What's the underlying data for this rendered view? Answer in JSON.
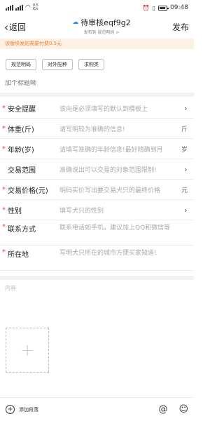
{
  "status_bar": {
    "net_speed": "0.5\nK/s",
    "time": "09:48"
  },
  "header": {
    "back_label": "返回",
    "title": "待审核eqf9g2",
    "subtitle": "发布到 规范明码 >",
    "publish_label": "发布"
  },
  "notice": "该版块发贴需要付费0.5元",
  "tags": [
    "规范明码",
    "对外配种",
    "求购类"
  ],
  "title_input": {
    "placeholder": "加个标题呦"
  },
  "form_rows": [
    {
      "required": "*",
      "label": "安全提醒",
      "value": "该向是必须填写的默认到模板上",
      "suffix": "",
      "arrow": "›"
    },
    {
      "required": "*",
      "label": "体重(斤)",
      "value": "请写明较为准确的信息!",
      "suffix": "斤",
      "arrow": ""
    },
    {
      "required": "*",
      "label": "年龄(岁)",
      "value": "请填写准确的年龄信息!最好精确到月",
      "suffix": "岁",
      "arrow": ""
    },
    {
      "required": "",
      "label": "交易范围",
      "value": "准确说出可以交易的对象范围限制!",
      "suffix": "",
      "arrow": "›"
    },
    {
      "required": "*",
      "label": "交易价格(元)",
      "value": "明码实价写出要交易犬只的最终价格",
      "suffix": "元",
      "arrow": ""
    },
    {
      "required": "*",
      "label": "性别",
      "value": "填写犬只的性别",
      "suffix": "",
      "arrow": "›"
    },
    {
      "required": "*",
      "label": "联系方式",
      "value": "联系电话如手机，建议加上QQ和微信等",
      "suffix": "",
      "arrow": ""
    },
    {
      "required": "*",
      "label": "所在地",
      "value": "写明犬只所在的城市方便买家知道!",
      "suffix": "",
      "arrow": ""
    }
  ],
  "content_placeholder": "内容",
  "bottom_bar": {
    "add_paragraph": "添加段落",
    "at_symbol": "@",
    "emoji_symbol": "☺"
  },
  "colors": {
    "accent_orange": "#ef7d2b",
    "notice_bg": "#fdf0e4",
    "required_red": "#e23c2e",
    "cloud_blue": "#2f8ee8"
  }
}
